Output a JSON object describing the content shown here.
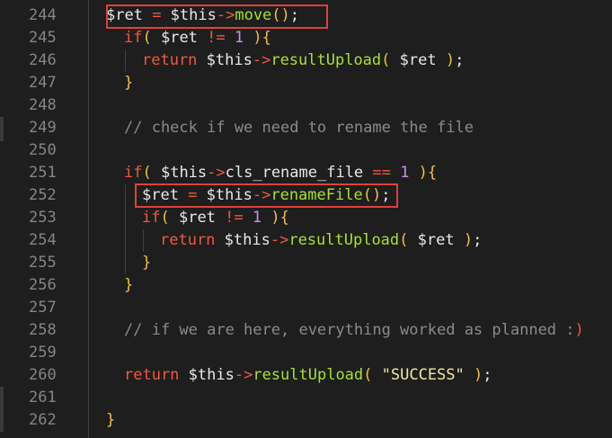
{
  "lines": [
    {
      "n": "244",
      "indent": 0,
      "tokens": [
        [
          "var",
          "$ret"
        ],
        [
          "op",
          " = "
        ],
        [
          "var",
          "$this"
        ],
        [
          "op",
          "->"
        ],
        [
          "fn",
          "move"
        ],
        [
          "pa",
          "()"
        ],
        [
          "var",
          ";"
        ]
      ]
    },
    {
      "n": "245",
      "indent": 1,
      "tokens": [
        [
          "kw",
          "if"
        ],
        [
          "pa",
          "( "
        ],
        [
          "var",
          "$ret "
        ],
        [
          "op",
          "!="
        ],
        [
          "num",
          " 1"
        ],
        [
          "pa",
          " ){"
        ]
      ]
    },
    {
      "n": "246",
      "indent": 2,
      "tokens": [
        [
          "kw",
          "return "
        ],
        [
          "var",
          "$this"
        ],
        [
          "op",
          "->"
        ],
        [
          "fn",
          "resultUpload"
        ],
        [
          "pa",
          "( "
        ],
        [
          "var",
          "$ret "
        ],
        [
          "pa",
          ")"
        ],
        [
          "var",
          ";"
        ]
      ]
    },
    {
      "n": "247",
      "indent": 1,
      "tokens": [
        [
          "pa",
          "}"
        ]
      ]
    },
    {
      "n": "248",
      "indent": 0,
      "tokens": []
    },
    {
      "n": "249",
      "indent": 1,
      "tokens": [
        [
          "cm",
          "// check if we need to rename the file"
        ]
      ]
    },
    {
      "n": "250",
      "indent": 0,
      "tokens": []
    },
    {
      "n": "251",
      "indent": 1,
      "tokens": [
        [
          "kw",
          "if"
        ],
        [
          "pa",
          "( "
        ],
        [
          "var",
          "$this"
        ],
        [
          "op",
          "->"
        ],
        [
          "var",
          "cls_rename_file "
        ],
        [
          "op",
          "=="
        ],
        [
          "num",
          " 1"
        ],
        [
          "pa",
          " ){"
        ]
      ]
    },
    {
      "n": "252",
      "indent": 2,
      "tokens": [
        [
          "var",
          "$ret"
        ],
        [
          "op",
          " = "
        ],
        [
          "var",
          "$this"
        ],
        [
          "op",
          "->"
        ],
        [
          "fn",
          "renameFile"
        ],
        [
          "pa",
          "()"
        ],
        [
          "var",
          ";"
        ]
      ]
    },
    {
      "n": "253",
      "indent": 2,
      "tokens": [
        [
          "kw",
          "if"
        ],
        [
          "pa",
          "( "
        ],
        [
          "var",
          "$ret "
        ],
        [
          "op",
          "!="
        ],
        [
          "num",
          " 1"
        ],
        [
          "pa",
          " ){"
        ]
      ]
    },
    {
      "n": "254",
      "indent": 3,
      "tokens": [
        [
          "kw",
          "return "
        ],
        [
          "var",
          "$this"
        ],
        [
          "op",
          "->"
        ],
        [
          "fn",
          "resultUpload"
        ],
        [
          "pa",
          "( "
        ],
        [
          "var",
          "$ret "
        ],
        [
          "pa",
          ")"
        ],
        [
          "var",
          ";"
        ]
      ]
    },
    {
      "n": "255",
      "indent": 2,
      "tokens": [
        [
          "pa",
          "}"
        ]
      ]
    },
    {
      "n": "256",
      "indent": 1,
      "tokens": [
        [
          "pa",
          "}"
        ]
      ]
    },
    {
      "n": "257",
      "indent": 0,
      "tokens": []
    },
    {
      "n": "258",
      "indent": 1,
      "tokens": [
        [
          "cm",
          "// if we are here, everything worked as planned :"
        ],
        [
          "kw",
          ")"
        ]
      ]
    },
    {
      "n": "259",
      "indent": 0,
      "tokens": []
    },
    {
      "n": "260",
      "indent": 1,
      "tokens": [
        [
          "kw",
          "return "
        ],
        [
          "var",
          "$this"
        ],
        [
          "op",
          "->"
        ],
        [
          "fn",
          "resultUpload"
        ],
        [
          "pa",
          "( "
        ],
        [
          "str",
          "\"SUCCESS\" "
        ],
        [
          "pa",
          ")"
        ],
        [
          "var",
          ";"
        ]
      ]
    },
    {
      "n": "261",
      "indent": 0,
      "tokens": []
    },
    {
      "n": "262",
      "indent": 0,
      "tokens": [
        [
          "pa",
          "}"
        ]
      ]
    }
  ],
  "colors": {
    "highlight_box": "#e0403a",
    "background": "#1e1e1e"
  }
}
